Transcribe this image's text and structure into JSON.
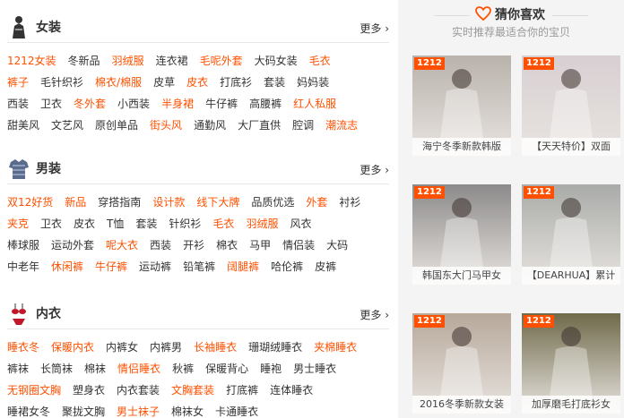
{
  "sections": [
    {
      "title": "女装",
      "more": "更多",
      "rows": [
        [
          {
            "t": "1212女装",
            "hot": true
          },
          {
            "t": "冬新品",
            "hot": false
          },
          {
            "t": "羽绒服",
            "hot": true
          },
          {
            "t": "连衣裙",
            "hot": false
          },
          {
            "t": "毛呢外套",
            "hot": true
          },
          {
            "t": "大码女装",
            "hot": false
          },
          {
            "t": "毛衣",
            "hot": true
          }
        ],
        [
          {
            "t": "裤子",
            "hot": true
          },
          {
            "t": "毛针织衫",
            "hot": false
          },
          {
            "t": "棉衣/棉服",
            "hot": true
          },
          {
            "t": "皮草",
            "hot": false
          },
          {
            "t": "皮衣",
            "hot": true
          },
          {
            "t": "打底衫",
            "hot": false
          },
          {
            "t": "套装",
            "hot": false
          },
          {
            "t": "妈妈装",
            "hot": false
          }
        ],
        [
          {
            "t": "西装",
            "hot": false
          },
          {
            "t": "卫衣",
            "hot": false
          },
          {
            "t": "冬外套",
            "hot": true
          },
          {
            "t": "小西装",
            "hot": false
          },
          {
            "t": "半身裙",
            "hot": true
          },
          {
            "t": "牛仔裤",
            "hot": false
          },
          {
            "t": "高腰裤",
            "hot": false
          },
          {
            "t": "红人私服",
            "hot": true
          }
        ],
        [
          {
            "t": "甜美风",
            "hot": false
          },
          {
            "t": "文艺风",
            "hot": false
          },
          {
            "t": "原创单品",
            "hot": false
          },
          {
            "t": "街头风",
            "hot": true
          },
          {
            "t": "通勤风",
            "hot": false
          },
          {
            "t": "大厂直供",
            "hot": false
          },
          {
            "t": "腔调",
            "hot": false
          },
          {
            "t": "潮流志",
            "hot": true
          }
        ]
      ]
    },
    {
      "title": "男装",
      "more": "更多",
      "rows": [
        [
          {
            "t": "双12好货",
            "hot": true
          },
          {
            "t": "新品",
            "hot": true
          },
          {
            "t": "穿搭指南",
            "hot": false
          },
          {
            "t": "设计款",
            "hot": true
          },
          {
            "t": "线下大牌",
            "hot": true
          },
          {
            "t": "品质优选",
            "hot": false
          },
          {
            "t": "外套",
            "hot": true
          },
          {
            "t": "衬衫",
            "hot": false
          }
        ],
        [
          {
            "t": "夹克",
            "hot": true
          },
          {
            "t": "卫衣",
            "hot": false
          },
          {
            "t": "皮衣",
            "hot": false
          },
          {
            "t": "T恤",
            "hot": false
          },
          {
            "t": "套装",
            "hot": false
          },
          {
            "t": "针织衫",
            "hot": false
          },
          {
            "t": "毛衣",
            "hot": true
          },
          {
            "t": "羽绒服",
            "hot": true
          },
          {
            "t": "风衣",
            "hot": false
          }
        ],
        [
          {
            "t": "棒球服",
            "hot": false
          },
          {
            "t": "运动外套",
            "hot": false
          },
          {
            "t": "呢大衣",
            "hot": true
          },
          {
            "t": "西装",
            "hot": false
          },
          {
            "t": "开衫",
            "hot": false
          },
          {
            "t": "棉衣",
            "hot": false
          },
          {
            "t": "马甲",
            "hot": false
          },
          {
            "t": "情侣装",
            "hot": false
          },
          {
            "t": "大码",
            "hot": false
          }
        ],
        [
          {
            "t": "中老年",
            "hot": false
          },
          {
            "t": "休闲裤",
            "hot": true
          },
          {
            "t": "牛仔裤",
            "hot": true
          },
          {
            "t": "运动裤",
            "hot": false
          },
          {
            "t": "铅笔裤",
            "hot": false
          },
          {
            "t": "阔腿裤",
            "hot": true
          },
          {
            "t": "哈伦裤",
            "hot": false
          },
          {
            "t": "皮裤",
            "hot": false
          }
        ]
      ]
    },
    {
      "title": "内衣",
      "more": "更多",
      "rows": [
        [
          {
            "t": "睡衣冬",
            "hot": true
          },
          {
            "t": "保暖内衣",
            "hot": true
          },
          {
            "t": "内裤女",
            "hot": false
          },
          {
            "t": "内裤男",
            "hot": false
          },
          {
            "t": "长袖睡衣",
            "hot": true
          },
          {
            "t": "珊瑚绒睡衣",
            "hot": false
          },
          {
            "t": "夹棉睡衣",
            "hot": true
          }
        ],
        [
          {
            "t": "裤袜",
            "hot": false
          },
          {
            "t": "长筒袜",
            "hot": false
          },
          {
            "t": "棉袜",
            "hot": false
          },
          {
            "t": "情侣睡衣",
            "hot": true
          },
          {
            "t": "秋裤",
            "hot": false
          },
          {
            "t": "保暖背心",
            "hot": false
          },
          {
            "t": "睡袍",
            "hot": false
          },
          {
            "t": "男士睡衣",
            "hot": false
          }
        ],
        [
          {
            "t": "无钢圈文胸",
            "hot": true
          },
          {
            "t": "塑身衣",
            "hot": false
          },
          {
            "t": "内衣套装",
            "hot": false
          },
          {
            "t": "文胸套装",
            "hot": true
          },
          {
            "t": "打底裤",
            "hot": false
          },
          {
            "t": "连体睡衣",
            "hot": false
          }
        ],
        [
          {
            "t": "睡裙女冬",
            "hot": false
          },
          {
            "t": "聚拢文胸",
            "hot": false
          },
          {
            "t": "男士袜子",
            "hot": true
          },
          {
            "t": "棉袜女",
            "hot": false
          },
          {
            "t": "卡通睡衣",
            "hot": false
          }
        ]
      ]
    }
  ],
  "guess": {
    "title": "猜你喜欢",
    "subtitle": "实时推荐最适合你的宝贝",
    "badge": "1212",
    "cards": [
      {
        "caption": "海宁冬季新款韩版",
        "bg": "#b9b2ac"
      },
      {
        "caption": "【天天特价】双面",
        "bg": "#d8cfd2"
      },
      {
        "caption": "韩国东大门马甲女",
        "bg": "#8c8a8a"
      },
      {
        "caption": "【DEARHUA】累计",
        "bg": "#a9aba8"
      },
      {
        "caption": "2016冬季新款女装",
        "bg": "#b7a89a"
      },
      {
        "caption": "加厚磨毛打底衫女",
        "bg": "#6f6a4a"
      }
    ]
  },
  "colors": {
    "accent": "#ff5000",
    "text": "#333333",
    "sidebar_bg": "#f4f4f4"
  },
  "icons": [
    "dress-icon",
    "shirt-icon",
    "lingerie-icon",
    "chevron-right-icon",
    "heart-icon"
  ]
}
